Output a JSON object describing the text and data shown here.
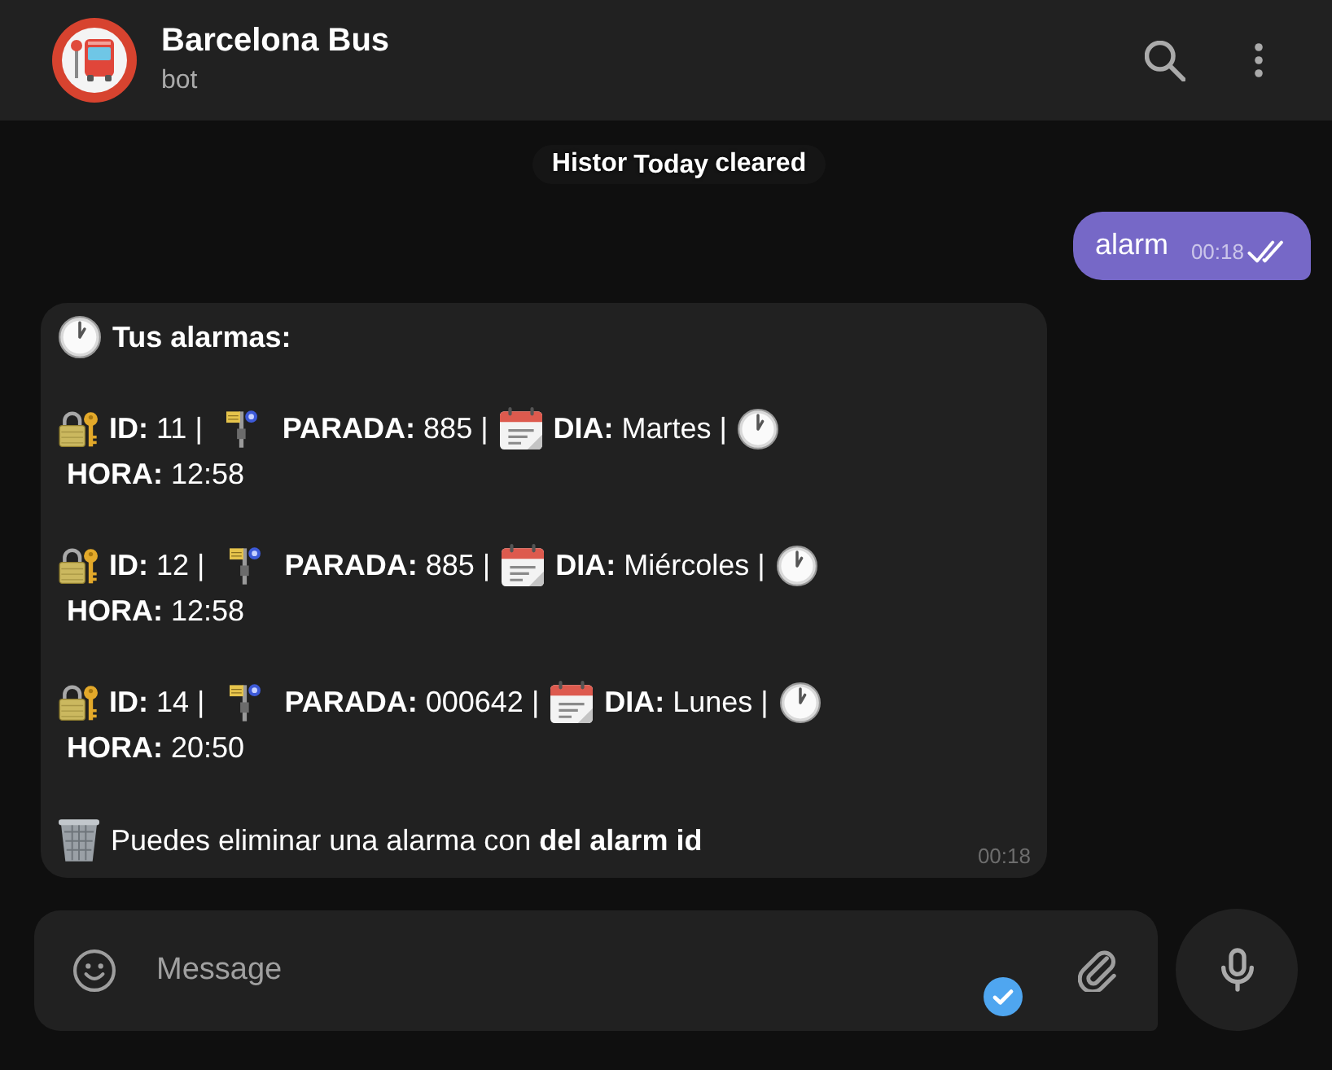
{
  "header": {
    "title": "Barcelona Bus",
    "subtitle": "bot"
  },
  "service": {
    "text_before": "Histor",
    "date_label": "Today",
    "text_after": "cleared"
  },
  "outgoing": {
    "text": "alarm",
    "time": "00:18",
    "read": true
  },
  "incoming": {
    "title": "Tus alarmas:",
    "alarms": [
      {
        "id": "**ID:** 11 |",
        "stop": "**PARADA:** 885 |",
        "day": "**DIA:** Martes |",
        "hour": "**HORA:** 12:58"
      },
      {
        "id": "**ID:** 12 |",
        "stop": "**PARADA:** 885 |",
        "day": "**DIA:** Miércoles |",
        "hour": "**HORA:** 12:58"
      },
      {
        "id": "**ID:** 14 |",
        "stop": "**PARADA:** 000642 |",
        "day": "**DIA:** Lunes |",
        "hour": "**HORA:** 20:50"
      }
    ],
    "footer": "Puedes eliminar una alarma con **del alarm id**",
    "time": "00:18"
  },
  "composer": {
    "placeholder": "Message"
  }
}
